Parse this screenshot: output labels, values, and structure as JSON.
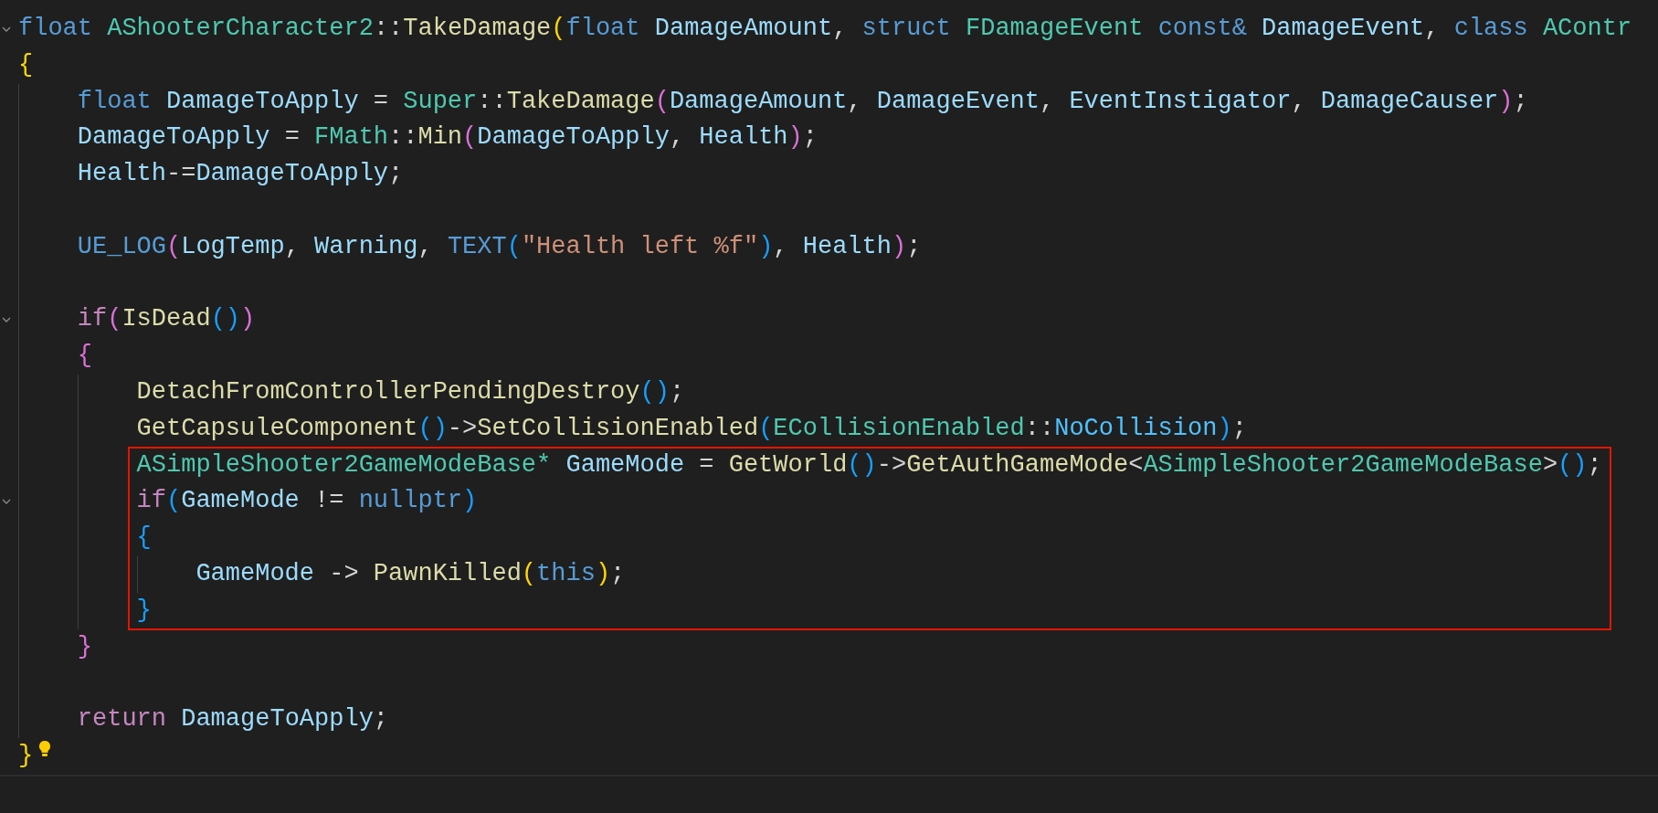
{
  "lines": [
    {
      "kind": "code",
      "foldable": true,
      "tokens": [
        {
          "text": "float ",
          "kind": "keyword"
        },
        {
          "text": "AShooterCharacter2",
          "kind": "type"
        },
        {
          "text": "::",
          "kind": "punct"
        },
        {
          "text": "TakeDamage",
          "kind": "function"
        },
        {
          "text": "(",
          "kind": "bracket1"
        },
        {
          "text": "float ",
          "kind": "keyword"
        },
        {
          "text": "DamageAmount",
          "kind": "variable"
        },
        {
          "text": ", ",
          "kind": "punct"
        },
        {
          "text": "struct ",
          "kind": "keyword"
        },
        {
          "text": "FDamageEvent ",
          "kind": "type"
        },
        {
          "text": "const& ",
          "kind": "keyword"
        },
        {
          "text": "DamageEvent",
          "kind": "variable"
        },
        {
          "text": ", ",
          "kind": "punct"
        },
        {
          "text": "class ",
          "kind": "keyword"
        },
        {
          "text": "AContr",
          "kind": "type"
        }
      ]
    },
    {
      "kind": "code",
      "tokens": [
        {
          "text": "{",
          "kind": "bracket1"
        }
      ],
      "children": [
        {
          "kind": "code",
          "tokens": [
            {
              "text": "float ",
              "kind": "keyword"
            },
            {
              "text": "DamageToApply",
              "kind": "variable"
            },
            {
              "text": " = ",
              "kind": "punct"
            },
            {
              "text": "Super",
              "kind": "type"
            },
            {
              "text": "::",
              "kind": "punct"
            },
            {
              "text": "TakeDamage",
              "kind": "function"
            },
            {
              "text": "(",
              "kind": "bracket2"
            },
            {
              "text": "DamageAmount",
              "kind": "variable"
            },
            {
              "text": ", ",
              "kind": "punct"
            },
            {
              "text": "DamageEvent",
              "kind": "variable"
            },
            {
              "text": ", ",
              "kind": "punct"
            },
            {
              "text": "EventInstigator",
              "kind": "variable"
            },
            {
              "text": ", ",
              "kind": "punct"
            },
            {
              "text": "DamageCauser",
              "kind": "variable"
            },
            {
              "text": ")",
              "kind": "bracket2"
            },
            {
              "text": ";",
              "kind": "punct"
            }
          ]
        },
        {
          "kind": "code",
          "tokens": [
            {
              "text": "DamageToApply",
              "kind": "variable"
            },
            {
              "text": " = ",
              "kind": "punct"
            },
            {
              "text": "FMath",
              "kind": "type"
            },
            {
              "text": "::",
              "kind": "punct"
            },
            {
              "text": "Min",
              "kind": "function"
            },
            {
              "text": "(",
              "kind": "bracket2"
            },
            {
              "text": "DamageToApply",
              "kind": "variable"
            },
            {
              "text": ", ",
              "kind": "punct"
            },
            {
              "text": "Health",
              "kind": "variable"
            },
            {
              "text": ")",
              "kind": "bracket2"
            },
            {
              "text": ";",
              "kind": "punct"
            }
          ]
        },
        {
          "kind": "code",
          "tokens": [
            {
              "text": "Health",
              "kind": "variable"
            },
            {
              "text": "-=",
              "kind": "punct"
            },
            {
              "text": "DamageToApply",
              "kind": "variable"
            },
            {
              "text": ";",
              "kind": "punct"
            }
          ]
        },
        {
          "kind": "blank"
        },
        {
          "kind": "code",
          "tokens": [
            {
              "text": "UE_LOG",
              "kind": "macro"
            },
            {
              "text": "(",
              "kind": "bracket2"
            },
            {
              "text": "LogTemp",
              "kind": "variable"
            },
            {
              "text": ", ",
              "kind": "punct"
            },
            {
              "text": "Warning",
              "kind": "variable"
            },
            {
              "text": ", ",
              "kind": "punct"
            },
            {
              "text": "TEXT",
              "kind": "macro"
            },
            {
              "text": "(",
              "kind": "bracket3"
            },
            {
              "text": "\"Health left %f\"",
              "kind": "string"
            },
            {
              "text": ")",
              "kind": "bracket3"
            },
            {
              "text": ", ",
              "kind": "punct"
            },
            {
              "text": "Health",
              "kind": "variable"
            },
            {
              "text": ")",
              "kind": "bracket2"
            },
            {
              "text": ";",
              "kind": "punct"
            }
          ]
        },
        {
          "kind": "blank"
        },
        {
          "kind": "code",
          "foldable": true,
          "tokens": [
            {
              "text": "if",
              "kind": "control"
            },
            {
              "text": "(",
              "kind": "bracket2"
            },
            {
              "text": "IsDead",
              "kind": "function"
            },
            {
              "text": "()",
              "kind": "bracket3"
            },
            {
              "text": ")",
              "kind": "bracket2"
            }
          ]
        },
        {
          "kind": "code",
          "tokens": [
            {
              "text": "{",
              "kind": "bracket2"
            }
          ],
          "children": [
            {
              "kind": "code",
              "tokens": [
                {
                  "text": "DetachFromControllerPendingDestroy",
                  "kind": "function"
                },
                {
                  "text": "()",
                  "kind": "bracket3"
                },
                {
                  "text": ";",
                  "kind": "punct"
                }
              ]
            },
            {
              "kind": "code",
              "tokens": [
                {
                  "text": "GetCapsuleComponent",
                  "kind": "function"
                },
                {
                  "text": "()",
                  "kind": "bracket3"
                },
                {
                  "text": "->",
                  "kind": "punct"
                },
                {
                  "text": "SetCollisionEnabled",
                  "kind": "function"
                },
                {
                  "text": "(",
                  "kind": "bracket3"
                },
                {
                  "text": "ECollisionEnabled",
                  "kind": "type"
                },
                {
                  "text": "::",
                  "kind": "punct"
                },
                {
                  "text": "NoCollision",
                  "kind": "enum"
                },
                {
                  "text": ")",
                  "kind": "bracket3"
                },
                {
                  "text": ";",
                  "kind": "punct"
                }
              ]
            },
            {
              "kind": "code",
              "highlight": true,
              "tokens": [
                {
                  "text": "ASimpleShooter2GameModeBase* ",
                  "kind": "type"
                },
                {
                  "text": "GameMode",
                  "kind": "variable"
                },
                {
                  "text": " = ",
                  "kind": "punct"
                },
                {
                  "text": "GetWorld",
                  "kind": "function"
                },
                {
                  "text": "()",
                  "kind": "bracket3"
                },
                {
                  "text": "->",
                  "kind": "punct"
                },
                {
                  "text": "GetAuthGameMode",
                  "kind": "function"
                },
                {
                  "text": "<",
                  "kind": "punct"
                },
                {
                  "text": "ASimpleShooter2GameModeBase",
                  "kind": "type"
                },
                {
                  "text": ">",
                  "kind": "punct"
                },
                {
                  "text": "()",
                  "kind": "bracket3"
                },
                {
                  "text": ";",
                  "kind": "punct"
                }
              ]
            },
            {
              "kind": "code",
              "highlight": true,
              "foldable": true,
              "tokens": [
                {
                  "text": "if",
                  "kind": "control"
                },
                {
                  "text": "(",
                  "kind": "bracket3"
                },
                {
                  "text": "GameMode",
                  "kind": "variable"
                },
                {
                  "text": " != ",
                  "kind": "punct"
                },
                {
                  "text": "nullptr",
                  "kind": "keyword"
                },
                {
                  "text": ")",
                  "kind": "bracket3"
                }
              ]
            },
            {
              "kind": "code",
              "highlight": true,
              "tokens": [
                {
                  "text": "{",
                  "kind": "bracket3"
                }
              ],
              "children": [
                {
                  "kind": "code",
                  "tokens": [
                    {
                      "text": "GameMode",
                      "kind": "variable"
                    },
                    {
                      "text": " -> ",
                      "kind": "punct"
                    },
                    {
                      "text": "PawnKilled",
                      "kind": "function"
                    },
                    {
                      "text": "(",
                      "kind": "bracket1"
                    },
                    {
                      "text": "this",
                      "kind": "keyword"
                    },
                    {
                      "text": ")",
                      "kind": "bracket1"
                    },
                    {
                      "text": ";",
                      "kind": "punct"
                    }
                  ]
                }
              ]
            },
            {
              "kind": "code",
              "highlight": true,
              "tokens": [
                {
                  "text": "}",
                  "kind": "bracket3"
                }
              ]
            }
          ]
        },
        {
          "kind": "code",
          "tokens": [
            {
              "text": "}",
              "kind": "bracket2"
            }
          ]
        },
        {
          "kind": "blank"
        },
        {
          "kind": "code",
          "tokens": [
            {
              "text": "return ",
              "kind": "control"
            },
            {
              "text": "DamageToApply",
              "kind": "variable"
            },
            {
              "text": ";",
              "kind": "punct"
            }
          ]
        }
      ]
    },
    {
      "kind": "code",
      "lightbulb": true,
      "tokens": [
        {
          "text": "}",
          "kind": "bracket1"
        }
      ]
    },
    {
      "kind": "blank",
      "current": true
    }
  ]
}
